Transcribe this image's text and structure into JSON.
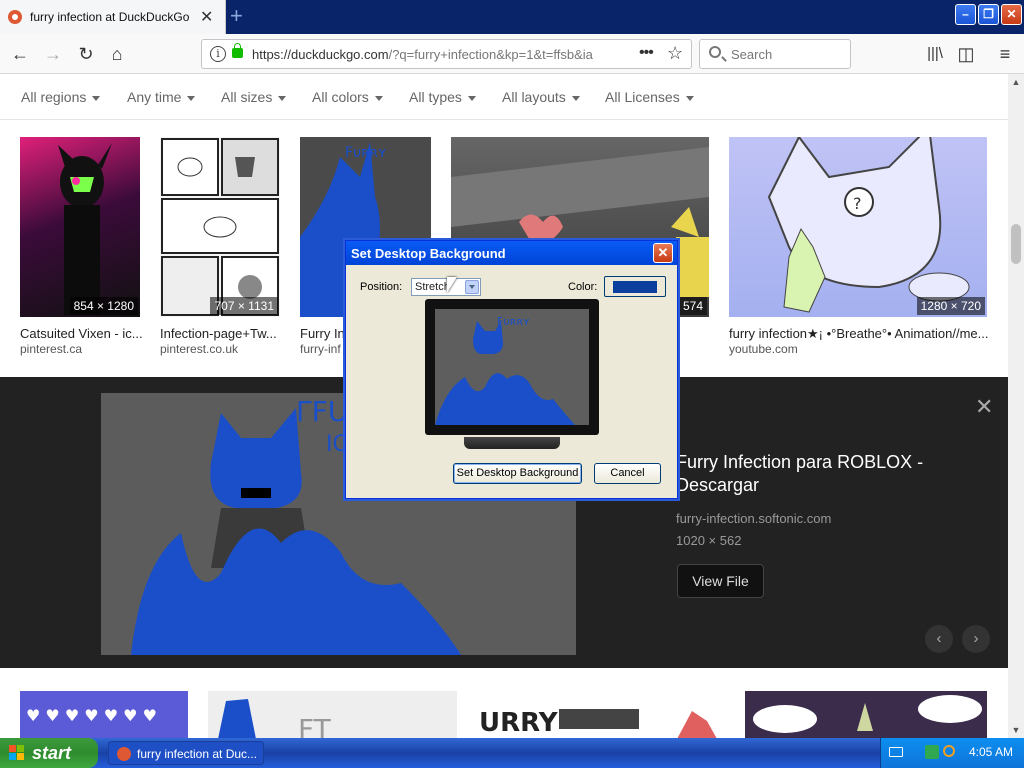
{
  "browser": {
    "tab_title": "furry infection at DuckDuckGo",
    "new_tab": "+",
    "url_main": "https://duckduckgo.com",
    "url_rest": "/?q=furry+infection&kp=1&t=ffsb&ia",
    "search_placeholder": "Search"
  },
  "filters": [
    "All regions",
    "Any time",
    "All sizes",
    "All colors",
    "All types",
    "All layouts",
    "All Licenses"
  ],
  "thumbnails": [
    {
      "dims": "854 × 1280",
      "caption": "Catsuited Vixen - ic...",
      "source": "pinterest.ca"
    },
    {
      "dims": "707 × 1131",
      "caption": "Infection-page+Tw...",
      "source": "pinterest.co.uk"
    },
    {
      "dims": "",
      "caption": "Furry In",
      "source": "furry-inf"
    },
    {
      "dims": "× 574",
      "caption": "",
      "source": ""
    },
    {
      "dims": "1280 × 720",
      "caption": "furry infection★¡ •°Breathe°• Animation//me...",
      "source": "youtube.com"
    }
  ],
  "detail": {
    "title": "Furry Infection para ROBLOX - Descargar",
    "source": "furry-infection.softonic.com",
    "size": "1020 × 562",
    "view_button": "View File",
    "close": "✕",
    "prev": "‹",
    "next": "›"
  },
  "dialog": {
    "title": "Set Desktop Background",
    "position_label": "Position:",
    "position_value": "Stretch",
    "color_label": "Color:",
    "color_value": "#0a3f9e",
    "set_button": "Set Desktop Background",
    "cancel_button": "Cancel"
  },
  "taskbar": {
    "start_label": "start",
    "task_label": "furry infection at Duc...",
    "clock": "4:05 AM"
  },
  "colors": {
    "accent": "#0a5cf5",
    "taskbar": "#245edb",
    "start_green": "#3c9a3c",
    "blue_ink": "#1a4fc9"
  }
}
